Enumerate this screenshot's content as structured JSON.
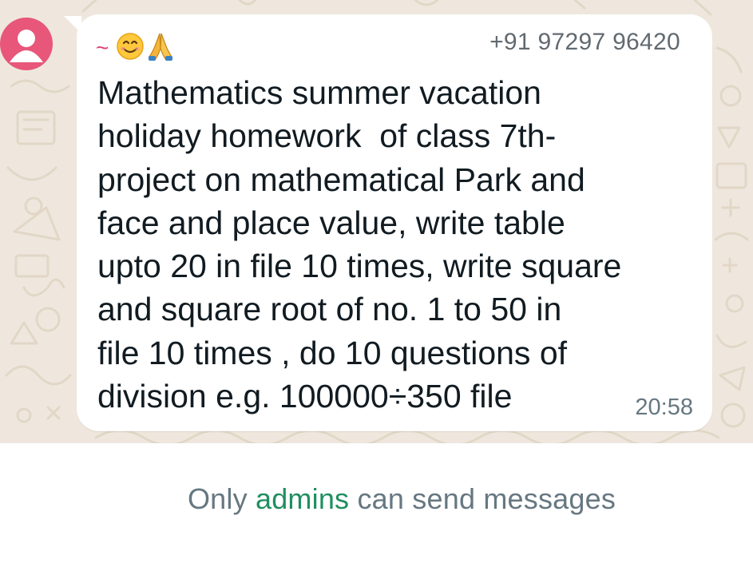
{
  "chat": {
    "sender": {
      "name_prefix": "~",
      "emoji": [
        "smiling-face-emoji",
        "folded-hands-emoji"
      ],
      "phone": "+91 97297 96420",
      "avatar_color": "#e8567a",
      "name_color": "#dd3f74"
    },
    "message": {
      "text": "Mathematics summer vacation\nholiday homework  of class 7th-\nproject on mathematical Park and\nface and place value, write table\nupto 20 in file 10 times, write square\nand square root of no. 1 to 50 in\nfile 10 times , do 10 questions of\ndivision e.g. 100000÷350 file",
      "time": "20:58"
    }
  },
  "footer": {
    "prefix": "Only",
    "link": "admins",
    "suffix": "can send messages",
    "link_color": "#1f8f5f"
  }
}
